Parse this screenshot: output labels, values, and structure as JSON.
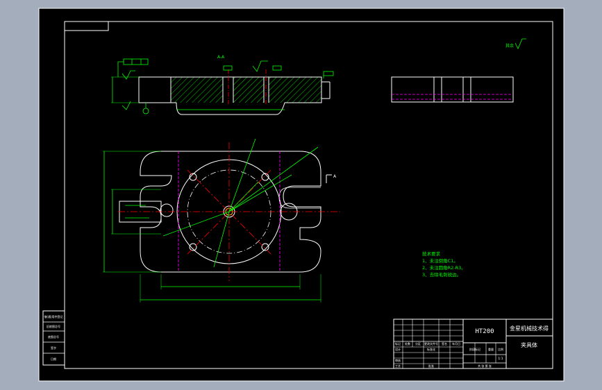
{
  "material": "HT200",
  "company": "金星机械技术得",
  "part_name": "夹具体",
  "section_label": "A-A",
  "view_label_a": "A",
  "surface_finish": "其余",
  "tech_requirements": {
    "title": "技术要求",
    "items": [
      "1、未注倒角C1。",
      "2、未注圆角R2-R3。",
      "3、去除毛刺锐边。"
    ]
  },
  "title_block": {
    "row_labels": [
      "标记",
      "处数",
      "分区",
      "更改文件号",
      "签名",
      "年月日"
    ],
    "design": "设计",
    "standard": "标准化",
    "review": "审核",
    "process": "工艺",
    "approve": "批准",
    "stage_mark": "阶段标记",
    "weight": "重量",
    "ratio": "比例",
    "ratio_value": "1:1",
    "sheets": "共 张 第 张"
  },
  "side_table": [
    "借(通)用件登记",
    "旧底图总号",
    "底图总号",
    "签字",
    "日期"
  ],
  "colors": {
    "background": "#000000",
    "outer_frame": "#ffffff",
    "line": "#ffffff",
    "dimension": "#00ff00",
    "center_line": "#ff0000",
    "hidden_line": "#ff00ff",
    "chrome": "#a3adbc"
  }
}
